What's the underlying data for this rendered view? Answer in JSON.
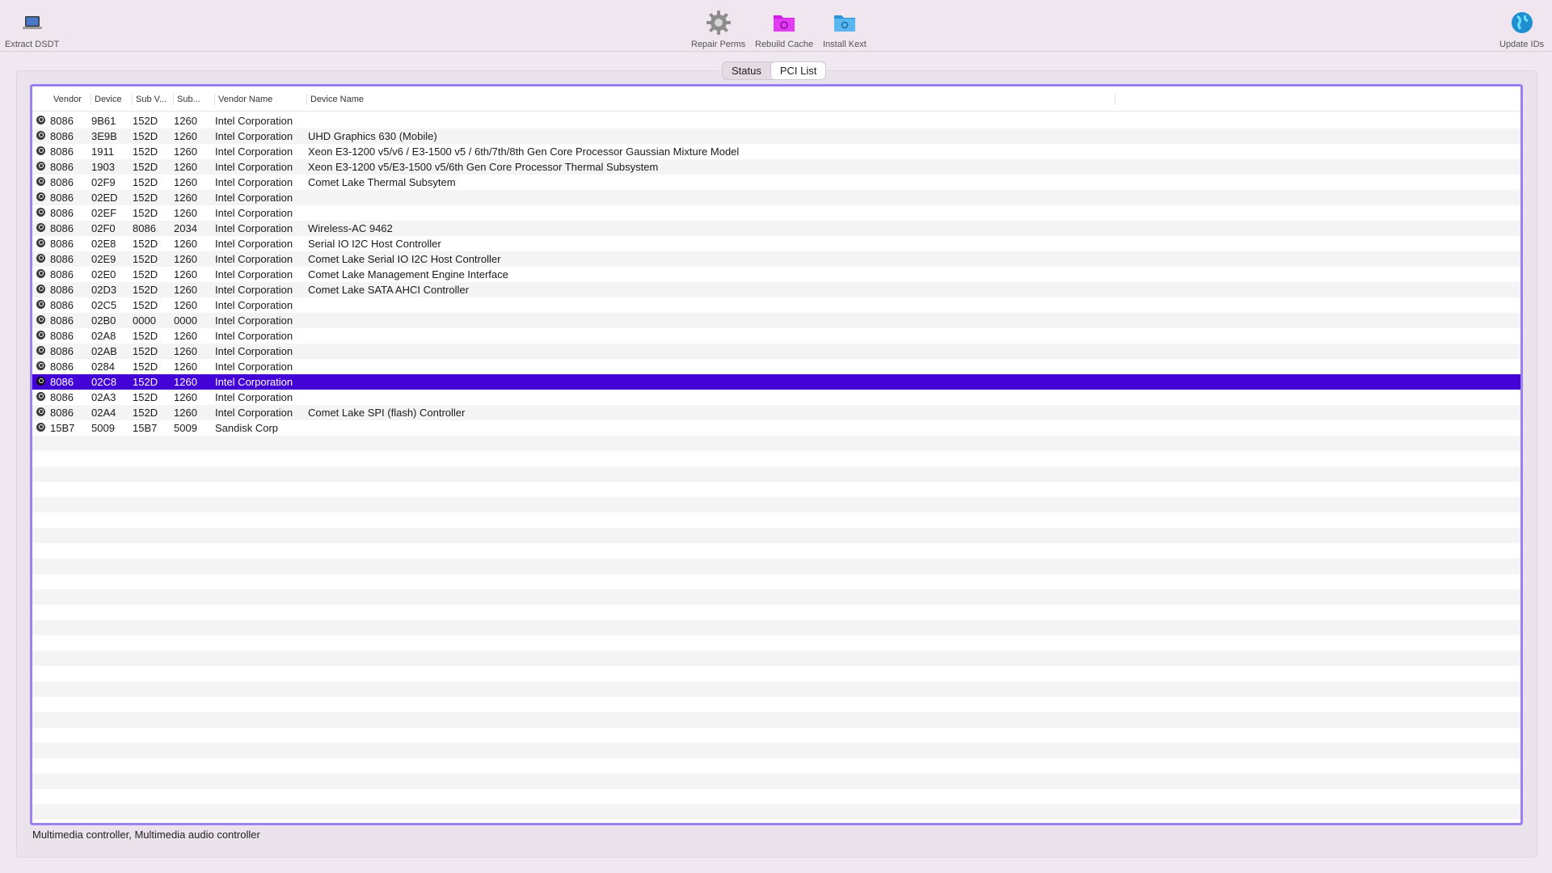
{
  "toolbar": {
    "extract_dsdt": "Extract DSDT",
    "repair_perms": "Repair Perms",
    "rebuild_cache": "Rebuild Cache",
    "install_kext": "Install Kext",
    "update_ids": "Update IDs"
  },
  "tabs": [
    "Status",
    "PCI List"
  ],
  "active_tab": "PCI List",
  "columns": [
    "Vendor",
    "Device",
    "Sub V...",
    "Sub...",
    "Vendor Name",
    "Device Name"
  ],
  "rows": [
    [
      "8086",
      "9B61",
      "152D",
      "1260",
      "Intel Corporation",
      ""
    ],
    [
      "8086",
      "3E9B",
      "152D",
      "1260",
      "Intel Corporation",
      "UHD Graphics 630 (Mobile)"
    ],
    [
      "8086",
      "1911",
      "152D",
      "1260",
      "Intel Corporation",
      "Xeon E3-1200 v5/v6 / E3-1500 v5 / 6th/7th/8th Gen Core Processor Gaussian Mixture Model"
    ],
    [
      "8086",
      "1903",
      "152D",
      "1260",
      "Intel Corporation",
      "Xeon E3-1200 v5/E3-1500 v5/6th Gen Core Processor Thermal Subsystem"
    ],
    [
      "8086",
      "02F9",
      "152D",
      "1260",
      "Intel Corporation",
      "Comet Lake Thermal Subsytem"
    ],
    [
      "8086",
      "02ED",
      "152D",
      "1260",
      "Intel Corporation",
      ""
    ],
    [
      "8086",
      "02EF",
      "152D",
      "1260",
      "Intel Corporation",
      ""
    ],
    [
      "8086",
      "02F0",
      "8086",
      "2034",
      "Intel Corporation",
      "Wireless-AC 9462"
    ],
    [
      "8086",
      "02E8",
      "152D",
      "1260",
      "Intel Corporation",
      "Serial IO I2C Host Controller"
    ],
    [
      "8086",
      "02E9",
      "152D",
      "1260",
      "Intel Corporation",
      "Comet Lake Serial IO I2C Host Controller"
    ],
    [
      "8086",
      "02E0",
      "152D",
      "1260",
      "Intel Corporation",
      "Comet Lake Management Engine Interface"
    ],
    [
      "8086",
      "02D3",
      "152D",
      "1260",
      "Intel Corporation",
      "Comet Lake SATA AHCI Controller"
    ],
    [
      "8086",
      "02C5",
      "152D",
      "1260",
      "Intel Corporation",
      ""
    ],
    [
      "8086",
      "02B0",
      "0000",
      "0000",
      "Intel Corporation",
      ""
    ],
    [
      "8086",
      "02A8",
      "152D",
      "1260",
      "Intel Corporation",
      ""
    ],
    [
      "8086",
      "02AB",
      "152D",
      "1260",
      "Intel Corporation",
      ""
    ],
    [
      "8086",
      "0284",
      "152D",
      "1260",
      "Intel Corporation",
      ""
    ],
    [
      "8086",
      "02C8",
      "152D",
      "1260",
      "Intel Corporation",
      ""
    ],
    [
      "8086",
      "02A3",
      "152D",
      "1260",
      "Intel Corporation",
      ""
    ],
    [
      "8086",
      "02A4",
      "152D",
      "1260",
      "Intel Corporation",
      "Comet Lake SPI (flash) Controller"
    ],
    [
      "15B7",
      "5009",
      "15B7",
      "5009",
      "Sandisk Corp",
      ""
    ]
  ],
  "selected_row": 17,
  "status_text": "Multimedia controller, Multimedia audio controller",
  "colors": {
    "selection": "#4303d6",
    "focus_ring": "#9c7ff0",
    "rebuild_cache_icon": "#d21be6",
    "install_kext_icon": "#3aa6e8"
  },
  "icons": {
    "extract_dsdt": "laptop-icon",
    "repair_perms": "gear-icon",
    "rebuild_cache": "folder-gear-icon",
    "install_kext": "folder-kext-icon",
    "update_ids": "globe-icon",
    "row": "pci-device-icon"
  }
}
